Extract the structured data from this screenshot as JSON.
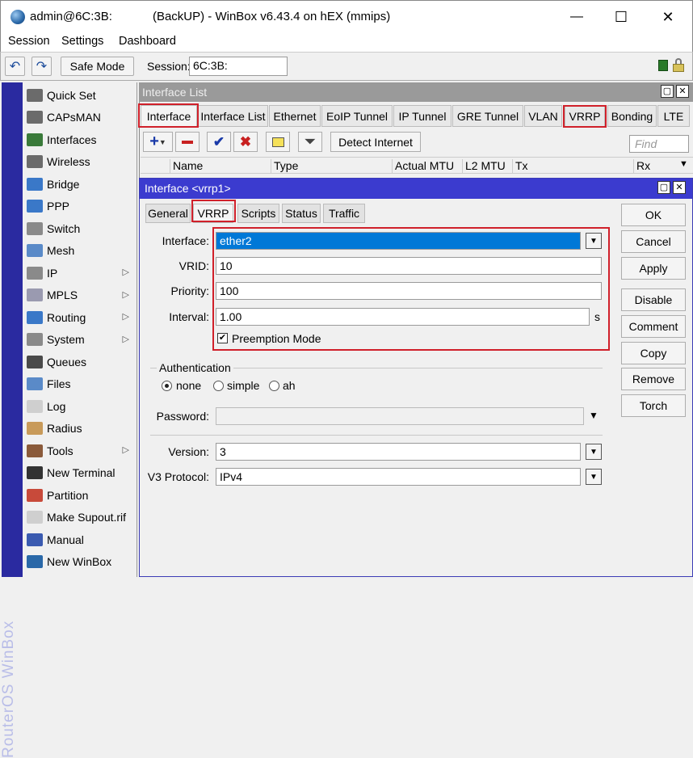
{
  "window": {
    "title": "admin@6C:3B:            (BackUP) - WinBox v6.43.4 on hEX (mmips)",
    "minimize": "—",
    "maximize": "☐",
    "close": "✕"
  },
  "menu": [
    "Session",
    "Settings",
    "Dashboard"
  ],
  "toolbar": {
    "undo_icon": "↶",
    "redo_icon": "↷",
    "safe_mode": "Safe Mode",
    "session_label": "Session:",
    "session_value": "6C:3B:"
  },
  "brand_vertical": "RouterOS WinBox",
  "sidebar": {
    "items": [
      {
        "label": "Quick Set",
        "icon": "quickset-icon",
        "color": "#6b6b6b",
        "sub": false
      },
      {
        "label": "CAPsMAN",
        "icon": "capsman-icon",
        "color": "#6b6b6b",
        "sub": false
      },
      {
        "label": "Interfaces",
        "icon": "interfaces-icon",
        "color": "#3a7a3a",
        "sub": false
      },
      {
        "label": "Wireless",
        "icon": "wireless-icon",
        "color": "#6b6b6b",
        "sub": false
      },
      {
        "label": "Bridge",
        "icon": "bridge-icon",
        "color": "#3a78c8",
        "sub": false
      },
      {
        "label": "PPP",
        "icon": "ppp-icon",
        "color": "#3a78c8",
        "sub": false
      },
      {
        "label": "Switch",
        "icon": "switch-icon",
        "color": "#8a8a8a",
        "sub": false
      },
      {
        "label": "Mesh",
        "icon": "mesh-icon",
        "color": "#5a8ac8",
        "sub": false
      },
      {
        "label": "IP",
        "icon": "ip-icon",
        "color": "#8a8a8a",
        "sub": true
      },
      {
        "label": "MPLS",
        "icon": "mpls-icon",
        "color": "#9a9ab0",
        "sub": true
      },
      {
        "label": "Routing",
        "icon": "routing-icon",
        "color": "#3a78c8",
        "sub": true
      },
      {
        "label": "System",
        "icon": "system-icon",
        "color": "#8a8a8a",
        "sub": true
      },
      {
        "label": "Queues",
        "icon": "queues-icon",
        "color": "#4a4a4a",
        "sub": false
      },
      {
        "label": "Files",
        "icon": "files-icon",
        "color": "#5a8ac8",
        "sub": false
      },
      {
        "label": "Log",
        "icon": "log-icon",
        "color": "#cfcfcf",
        "sub": false
      },
      {
        "label": "Radius",
        "icon": "radius-icon",
        "color": "#c89a5a",
        "sub": false
      },
      {
        "label": "Tools",
        "icon": "tools-icon",
        "color": "#8a5a3a",
        "sub": true
      },
      {
        "label": "New Terminal",
        "icon": "terminal-icon",
        "color": "#333333",
        "sub": false
      },
      {
        "label": "Partition",
        "icon": "partition-icon",
        "color": "#c84a3a",
        "sub": false
      },
      {
        "label": "Make Supout.rif",
        "icon": "supout-icon",
        "color": "#cfcfcf",
        "sub": false
      },
      {
        "label": "Manual",
        "icon": "manual-icon",
        "color": "#3a5ab0",
        "sub": false
      },
      {
        "label": "New WinBox",
        "icon": "winbox-icon",
        "color": "#2a68a8",
        "sub": false
      }
    ]
  },
  "interface_list": {
    "title": "Interface List",
    "tabs": [
      "Interface",
      "Interface List",
      "Ethernet",
      "EoIP Tunnel",
      "IP Tunnel",
      "GRE Tunnel",
      "VLAN",
      "VRRP",
      "Bonding",
      "LTE"
    ],
    "detect_internet": "Detect Internet",
    "find_placeholder": "Find",
    "columns": [
      "Name",
      "Type",
      "Actual MTU",
      "L2 MTU",
      "Tx",
      "Rx"
    ]
  },
  "dialog": {
    "title": "Interface <vrrp1>",
    "tabs": [
      "General",
      "VRRP",
      "Scripts",
      "Status",
      "Traffic"
    ],
    "interface_label": "Interface:",
    "interface_value": "ether2",
    "vrid_label": "VRID:",
    "vrid_value": "10",
    "priority_label": "Priority:",
    "priority_value": "100",
    "interval_label": "Interval:",
    "interval_value": "1.00",
    "interval_unit": "s",
    "preemption_label": "Preemption Mode",
    "preemption_checked": true,
    "auth_title": "Authentication",
    "auth_options": [
      "none",
      "simple",
      "ah"
    ],
    "auth_selected": "none",
    "password_label": "Password:",
    "password_value": "",
    "version_label": "Version:",
    "version_value": "3",
    "v3_label": "V3 Protocol:",
    "v3_value": "IPv4",
    "buttons": [
      "OK",
      "Cancel",
      "Apply",
      "Disable",
      "Comment",
      "Copy",
      "Remove",
      "Torch"
    ]
  },
  "colors": {
    "highlight_red": "#d0202a",
    "dialog_title_blue": "#3b3bcf",
    "sidebar_strip": "#2a2aa0",
    "selection_blue": "#0078d7"
  }
}
